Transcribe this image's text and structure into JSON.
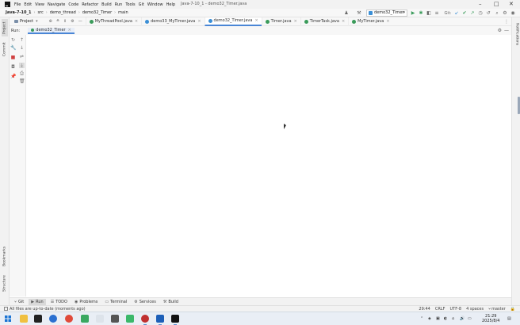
{
  "window": {
    "title": "Java-7-10_1 - demo32_Timer.java",
    "menu": [
      "File",
      "Edit",
      "View",
      "Navigate",
      "Code",
      "Refactor",
      "Build",
      "Run",
      "Tools",
      "Git",
      "Window",
      "Help"
    ],
    "controls": {
      "minimize": "–",
      "maximize": "□",
      "close": "✕"
    }
  },
  "navbar": {
    "breadcrumbs": [
      "Java-7-10_1",
      "src",
      "demo_thread",
      "demo32_Timer",
      "main"
    ],
    "run_config": "demo32_Timer",
    "git_label": "Git:"
  },
  "project_toolbar": {
    "project_label": "Project",
    "tabs": [
      {
        "label": "MyThreadPool.java",
        "color": "#3a9b5a"
      },
      {
        "label": "demo33_MyTimer.java",
        "color": "#3b8fd6"
      },
      {
        "label": "demo32_Timer.java",
        "color": "#3b8fd6",
        "active": true
      },
      {
        "label": "Timer.java",
        "color": "#3a9b5a"
      },
      {
        "label": "TimerTask.java",
        "color": "#3a9b5a"
      },
      {
        "label": "MyTimer.java",
        "color": "#3a9b5a"
      }
    ]
  },
  "run_panel": {
    "title": "Run:",
    "tab": "demo32_Timer"
  },
  "left_strip": {
    "top_tabs": [
      "Project",
      "Commit"
    ],
    "bottom_tabs": [
      "Bookmarks",
      "Structure"
    ]
  },
  "right_strip": {
    "tabs": [
      "Notifications"
    ]
  },
  "bottom_tools": [
    {
      "label": "Git",
      "icon": "git-icon"
    },
    {
      "label": "Run",
      "icon": "run-icon",
      "active": true
    },
    {
      "label": "TODO",
      "icon": "todo-icon"
    },
    {
      "label": "Problems",
      "icon": "problems-icon"
    },
    {
      "label": "Terminal",
      "icon": "terminal-icon"
    },
    {
      "label": "Services",
      "icon": "services-icon"
    },
    {
      "label": "Build",
      "icon": "build-icon"
    }
  ],
  "status": {
    "message": "All files are up-to-date (moments ago)",
    "position": "29:44",
    "line_ending": "CRLF",
    "encoding": "UTF-8",
    "indent": "4 spaces",
    "branch": "master"
  },
  "taskbar": {
    "time": "21:29",
    "date": "2025/8/4"
  }
}
